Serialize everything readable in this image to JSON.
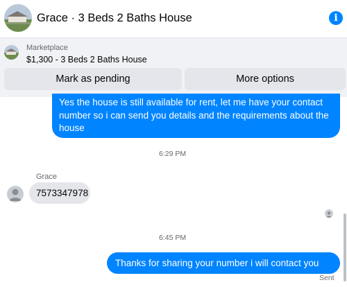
{
  "header": {
    "title": "Grace · 3 Beds 2 Baths House",
    "info_glyph": "i",
    "icon": "info-icon",
    "accent_color": "#0084ff"
  },
  "marketplace": {
    "label": "Marketplace",
    "listing": "$1,300 - 3 Beds 2 Baths House",
    "mark_pending_label": "Mark as pending",
    "more_options_label": "More options"
  },
  "messages": {
    "outgoing_1": "Yes the house is still available for rent, let me have your contact number so i can send you details and the requirements about the house",
    "time_1": "6:29 PM",
    "incoming_sender": "Grace",
    "incoming_1": "7573347978",
    "time_2": "6:45 PM",
    "outgoing_2": "Thanks for sharing your number i will contact you soon.",
    "status": "Sent",
    "outgoing_color": "#0084ff",
    "incoming_color": "#e4e6eb"
  }
}
